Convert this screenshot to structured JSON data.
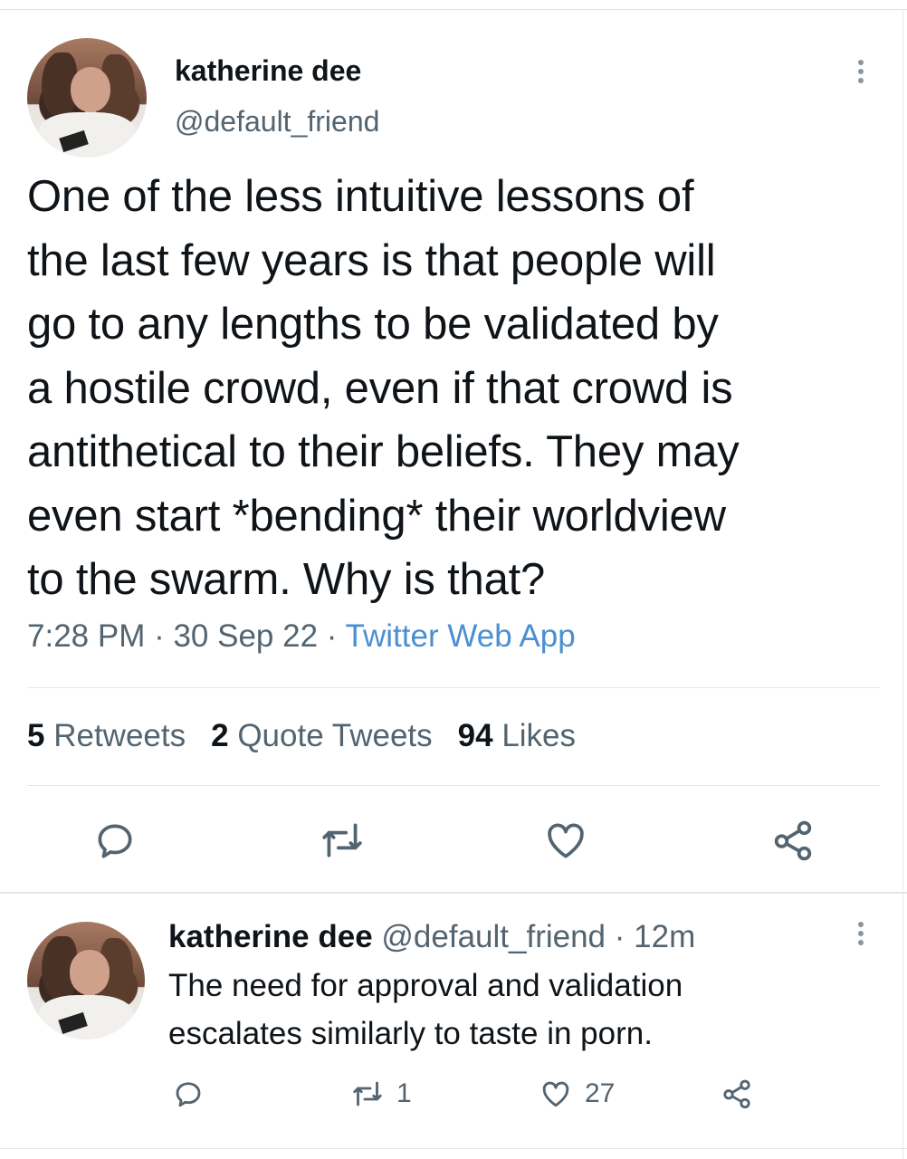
{
  "main_tweet": {
    "author_name": "katherine dee",
    "author_handle": "@default_friend",
    "text": "One of the less intuitive lessons of\nthe last few years is that people will\ngo to any lengths to be validated by\na hostile crowd, even if that crowd is\nantithetical to their beliefs. They may\neven start *bending* their worldview\nto the swarm. Why is that?",
    "time": "7:28 PM",
    "date": "30 Sep 22",
    "sep": " · ",
    "source": "Twitter Web App",
    "stats": {
      "retweets_count": "5",
      "retweets_label": "Retweets",
      "quotes_count": "2",
      "quotes_label": "Quote Tweets",
      "likes_count": "94",
      "likes_label": "Likes"
    }
  },
  "reply_tweet": {
    "author_name": "katherine dee",
    "author_handle": "@default_friend",
    "age": "12m",
    "sep": " · ",
    "text": "The need for approval and validation\nescalates similarly to taste in porn.",
    "retweet_count": "1",
    "like_count": "27"
  },
  "icons": [
    "reply-icon",
    "retweet-icon",
    "like-icon",
    "share-icon",
    "more-icon"
  ],
  "colors": {
    "text": "#0f1419",
    "secondary": "#536471",
    "link": "#4a8fd1",
    "icon": "#536471"
  }
}
